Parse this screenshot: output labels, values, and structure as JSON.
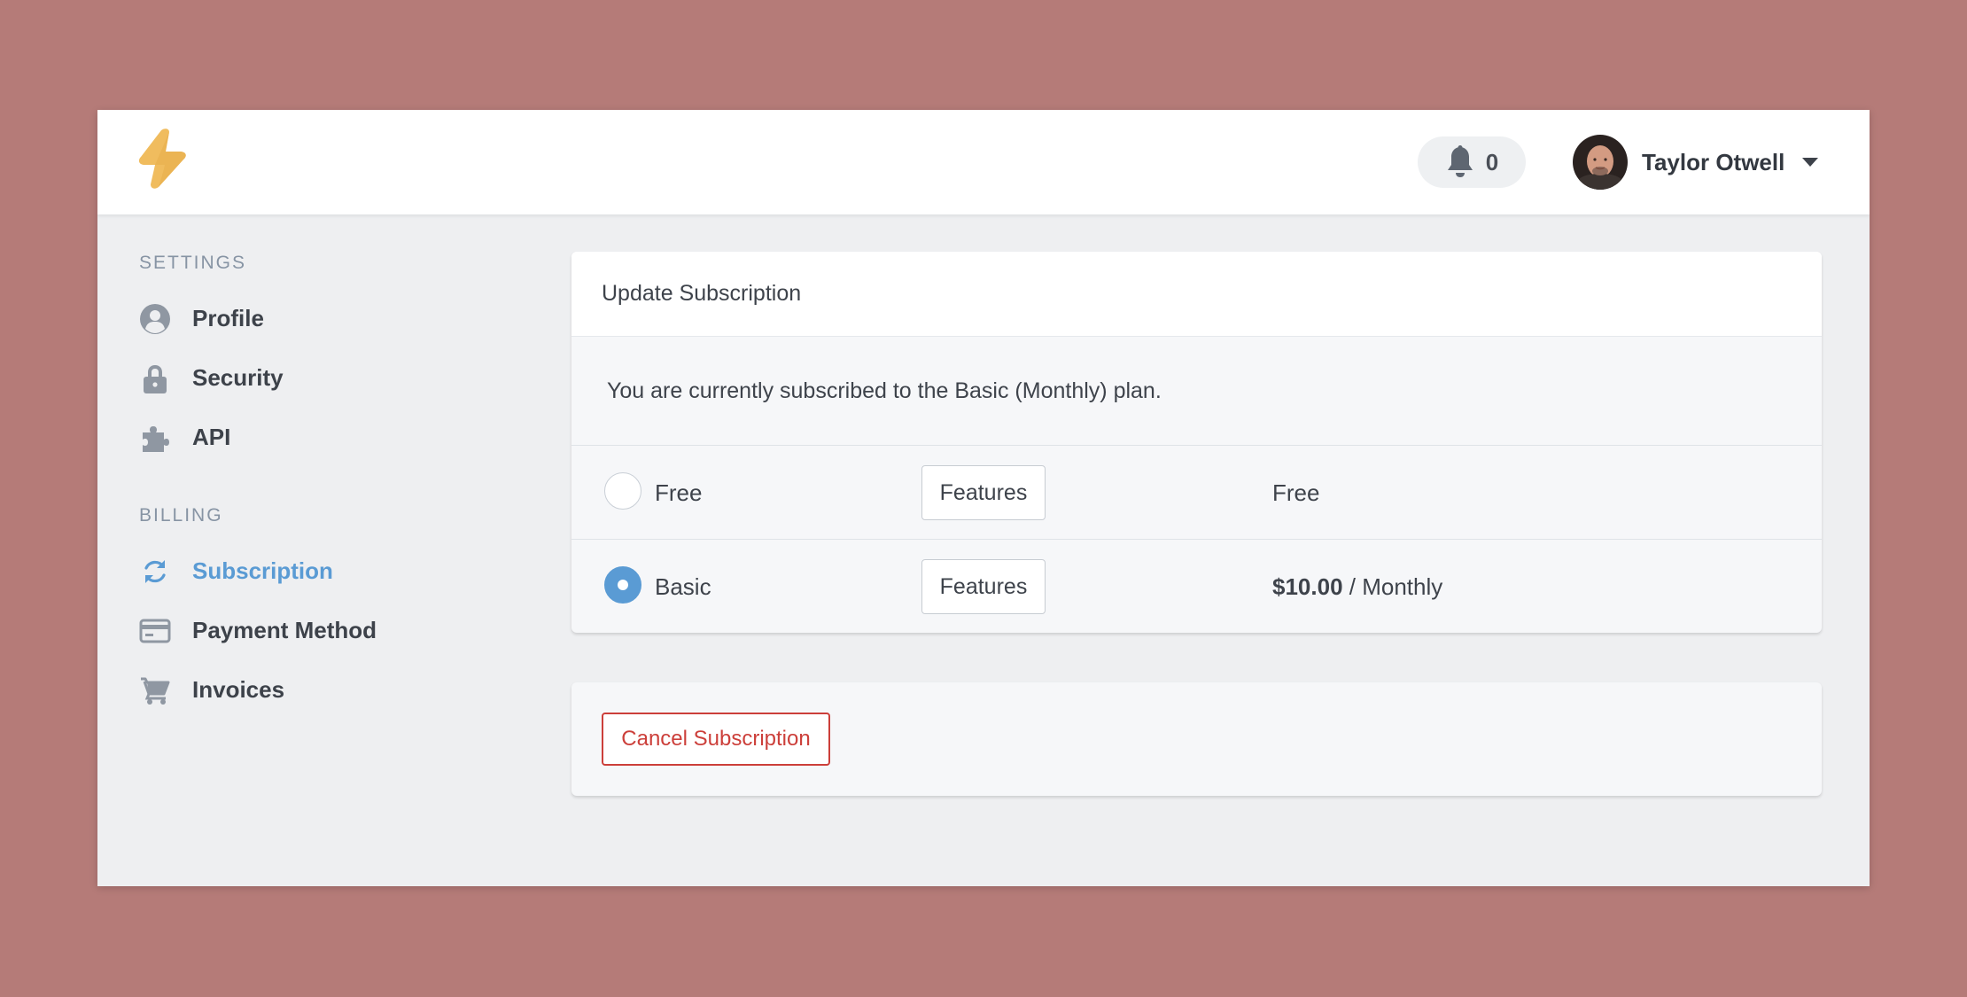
{
  "colors": {
    "background": "#b57b78",
    "accent": "#5a9bd4",
    "danger": "#cc3f3a",
    "logo": "#f0bc5e"
  },
  "header": {
    "logo_icon": "lightning-bolt-icon",
    "notifications": {
      "icon": "bell-icon",
      "count": "0"
    },
    "user": {
      "name": "Taylor Otwell",
      "caret_icon": "caret-down-icon"
    }
  },
  "sidebar": {
    "settings_title": "SETTINGS",
    "settings_items": [
      {
        "label": "Profile",
        "icon": "user-circle-icon"
      },
      {
        "label": "Security",
        "icon": "lock-icon"
      },
      {
        "label": "API",
        "icon": "puzzle-icon"
      }
    ],
    "billing_title": "BILLING",
    "billing_items": [
      {
        "label": "Subscription",
        "icon": "refresh-icon",
        "active": true
      },
      {
        "label": "Payment Method",
        "icon": "credit-card-icon"
      },
      {
        "label": "Invoices",
        "icon": "cart-icon"
      }
    ]
  },
  "subscription": {
    "title": "Update Subscription",
    "current_plan_text": "You are currently subscribed to the Basic (Monthly) plan.",
    "plans": [
      {
        "name": "Free",
        "features_label": "Features",
        "price": "Free",
        "selected": false
      },
      {
        "name": "Basic",
        "features_label": "Features",
        "price_amount": "$10.00",
        "price_period": " / Monthly",
        "selected": true
      }
    ]
  },
  "cancel": {
    "label": "Cancel Subscription"
  }
}
